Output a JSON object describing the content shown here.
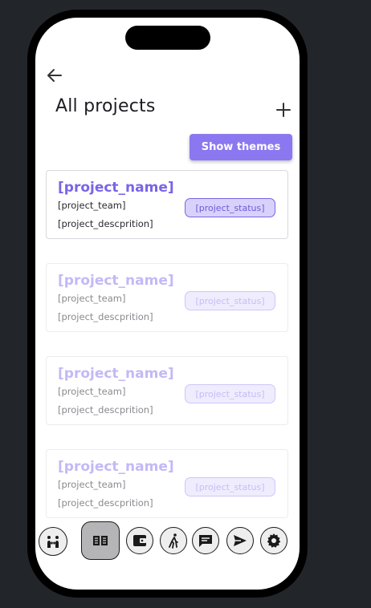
{
  "header": {
    "title": "All projects",
    "show_themes_label": "Show themes"
  },
  "projects": [
    {
      "name": "[project_name]",
      "team": "[project_team]",
      "description": "[project_descprition]",
      "status": "[project_status]"
    },
    {
      "name": "[project_name]",
      "team": "[project_team]",
      "description": "[project_descprition]",
      "status": "[project_status]"
    },
    {
      "name": "[project_name]",
      "team": "[project_team]",
      "description": "[project_descprition]",
      "status": "[project_status]"
    },
    {
      "name": "[project_name]",
      "team": "[project_team]",
      "description": "[project_descprition]",
      "status": "[project_status]"
    }
  ],
  "navbar": {
    "items": [
      "team-icon",
      "projects-book-icon",
      "wallet-icon",
      "activity-icon",
      "chat-icon",
      "send-icon",
      "settings-gear-icon"
    ],
    "active_index": 1
  },
  "colors": {
    "accent": "#8b78f0",
    "project_name": "#7a64e6",
    "status_bg": "#d8d2fb",
    "background": "#22252a"
  }
}
